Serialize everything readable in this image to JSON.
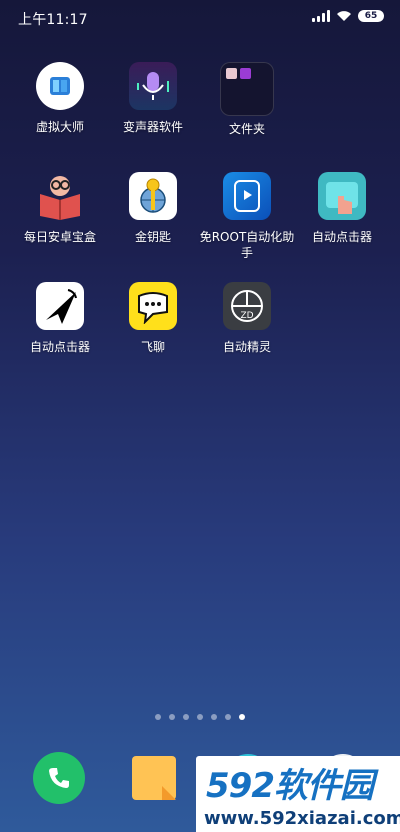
{
  "status_bar": {
    "time": "上午11:17",
    "battery": "65"
  },
  "apps": [
    {
      "label": "虚拟大师",
      "icon": "virtual-master-icon"
    },
    {
      "label": "变声器软件",
      "icon": "voice-changer-icon"
    },
    {
      "label": "文件夹",
      "icon": "folder-icon"
    },
    {
      "label": "每日安卓宝盒",
      "icon": "android-box-icon"
    },
    {
      "label": "金钥匙",
      "icon": "golden-key-icon"
    },
    {
      "label": "免ROOT自动化助手",
      "icon": "automation-helper-icon"
    },
    {
      "label": "自动点击器",
      "icon": "auto-clicker-icon"
    },
    {
      "label": "自动点击器",
      "icon": "cursor-clicker-icon"
    },
    {
      "label": "飞聊",
      "icon": "feiliao-icon"
    },
    {
      "label": "自动精灵",
      "icon": "auto-sprite-icon"
    }
  ],
  "page_indicator": {
    "count": 7,
    "active": 7
  },
  "dock": [
    "phone-icon",
    "notes-icon",
    "browser-icon",
    "camera-icon"
  ],
  "watermark": {
    "logo": "592软件园",
    "url": "www.592xiazai.com"
  }
}
